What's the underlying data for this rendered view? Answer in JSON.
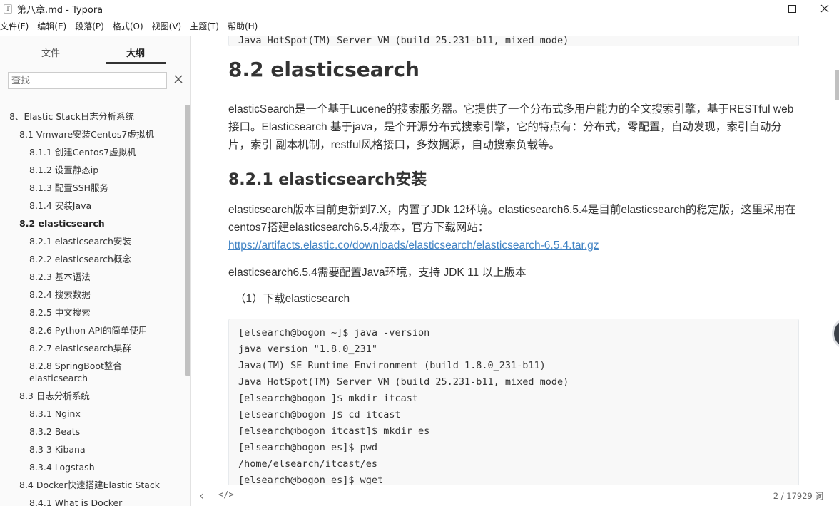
{
  "window": {
    "icon_letter": "T",
    "title": "第八章.md - Typora"
  },
  "menu": [
    "文件(F)",
    "编辑(E)",
    "段落(P)",
    "格式(O)",
    "视图(V)",
    "主题(T)",
    "帮助(H)"
  ],
  "sidebar": {
    "tabs": [
      "文件",
      "大纲"
    ],
    "active_tab": "大纲",
    "search_placeholder": "查找",
    "outline": [
      {
        "text": "8、Elastic Stack日志分析系统",
        "level": 1
      },
      {
        "text": "8.1 Vmware安装Centos7虚拟机",
        "level": 2
      },
      {
        "text": "8.1.1 创建Centos7虚拟机",
        "level": 3
      },
      {
        "text": "8.1.2 设置静态ip",
        "level": 3
      },
      {
        "text": "8.1.3 配置SSH服务",
        "level": 3
      },
      {
        "text": "8.1.4 安装Java",
        "level": 3
      },
      {
        "text": "8.2 elasticsearch",
        "level": 2,
        "active": true
      },
      {
        "text": "8.2.1 elasticsearch安装",
        "level": 3
      },
      {
        "text": "8.2.2 elasticsearch概念",
        "level": 3
      },
      {
        "text": "8.2.3 基本语法",
        "level": 3
      },
      {
        "text": "8.2.4 搜索数据",
        "level": 3
      },
      {
        "text": "8.2.5 中文搜索",
        "level": 3
      },
      {
        "text": "8.2.6 Python API的简单使用",
        "level": 3
      },
      {
        "text": "8.2.7 elasticsearch集群",
        "level": 3
      },
      {
        "text": "8.2.8 SpringBoot整合elasticsearch",
        "level": 3
      },
      {
        "text": "8.3 日志分析系统",
        "level": 2
      },
      {
        "text": "8.3.1 Nginx",
        "level": 3
      },
      {
        "text": "8.3.2 Beats",
        "level": 3
      },
      {
        "text": "8.3 3 Kibana",
        "level": 3
      },
      {
        "text": "8.3.4 Logstash",
        "level": 3
      },
      {
        "text": "8.4 Docker快速搭建Elastic Stack",
        "level": 2
      },
      {
        "text": "8.4.1 What is Docker",
        "level": 3
      }
    ]
  },
  "document": {
    "code_top_line": "Java HotSpot(TM) Server VM (build 25.231-b11, mixed mode)",
    "h2": "8.2 elasticsearch",
    "p1": "elasticSearch是一个基于Lucene的搜索服务器。它提供了一个分布式多用户能力的全文搜索引擎，基于RESTful web接口。Elasticsearch 基于java，是个开源分布式搜索引擎，它的特点有：分布式，零配置，自动发现，索引自动分片，索引 副本机制，restful风格接口，多数据源，自动搜索负载等。",
    "h3": "8.2.1 elasticsearch安装",
    "p2_text": "elasticsearch版本目前更新到7.X，内置了JDk 12环境。elasticsearch6.5.4是目前elasticsearch的稳定版，这里采用在centos7搭建elasticsearch6.5.4版本，官方下载网站：",
    "p2_link": "https://artifacts.elastic.co/downloads/elasticsearch/elasticsearch-6.5.4.tar.gz",
    "p3": "elasticsearch6.5.4需要配置Java环境，支持 JDK 11 以上版本",
    "p4": "（1）下载elasticsearch",
    "code_lines": [
      "[elsearch@bogon ~]$ java -version",
      "java version \"1.8.0_231\"",
      "Java(TM) SE Runtime Environment (build 1.8.0_231-b11)",
      "Java HotSpot(TM) Server VM (build 25.231-b11, mixed mode)",
      "[elsearch@bogon ]$ mkdir itcast",
      "[elsearch@bogon ]$ cd itcast",
      "[elsearch@bogon itcast]$ mkdir es",
      "[elsearch@bogon es]$ pwd",
      "/home/elsearch/itcast/es",
      "[elsearch@bogon es]$ wget"
    ]
  },
  "statusbar": {
    "back_glyph": "‹",
    "source_glyph": "</>",
    "word_count": "2 / 17929 词"
  }
}
